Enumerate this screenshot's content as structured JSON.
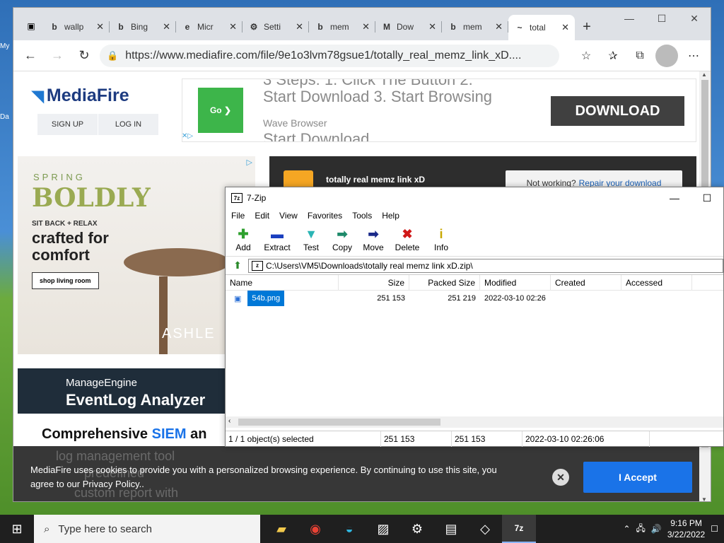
{
  "desktop": {
    "labels": [
      "My",
      "Da"
    ]
  },
  "browser": {
    "tabs": [
      {
        "label": "wallp",
        "fav": "b"
      },
      {
        "label": "Bing",
        "fav": "b"
      },
      {
        "label": "Micr",
        "fav": "e"
      },
      {
        "label": "Setti",
        "fav": "⚙"
      },
      {
        "label": "mem",
        "fav": "b"
      },
      {
        "label": "Dow",
        "fav": "M"
      },
      {
        "label": "mem",
        "fav": "b"
      },
      {
        "label": "total",
        "fav": "~"
      }
    ],
    "url": "https://www.mediafire.com/file/9e1o3lvm78gsue1/totally_real_memz_link_xD...."
  },
  "page": {
    "logo": "MediaFire",
    "signup": "SIGN UP",
    "login": "LOG IN",
    "top_ad": {
      "go": "Go ❯",
      "line1": "3 Steps: 1. Click The Button 2.",
      "line2": "Start Download 3. Start Browsing",
      "line3": "Wave Browser",
      "line4": "Start Download",
      "download": "DOWNLOAD"
    },
    "side_ad": {
      "spring": "SPRING",
      "boldly": "BOLDLY",
      "sit": "SIT BACK + RELAX",
      "crafted": "crafted for comfort",
      "cta": "shop living room",
      "brand": "ASHLE"
    },
    "manage_ad": {
      "line1": "ManageEngine",
      "line2": "EventLog Analyzer"
    },
    "siem": {
      "pre": "Comprehensive ",
      "blue": "SIEM",
      "post": " an"
    },
    "file_name": "totally real memz link xD",
    "not_working": "Not working?",
    "repair": "Repair your download",
    "cookie": {
      "text": "MediaFire uses cookies to provide you with a personalized browsing experience. By continuing to use this site, you agree to our Privacy Policy..",
      "accept": "I Accept",
      "ghost1": "log management tool",
      "ghost2": "predefined",
      "ghost3": "custom report with"
    }
  },
  "zip": {
    "title": "7-Zip",
    "menu": [
      "File",
      "Edit",
      "View",
      "Favorites",
      "Tools",
      "Help"
    ],
    "toolbar": [
      {
        "label": "Add",
        "icon": "plus-icon",
        "glyph": "✚",
        "color": "#2ea02e"
      },
      {
        "label": "Extract",
        "icon": "minus-icon",
        "glyph": "▬",
        "color": "#1a3fbf"
      },
      {
        "label": "Test",
        "icon": "check-icon",
        "glyph": "▼",
        "color": "#2bb5b5"
      },
      {
        "label": "Copy",
        "icon": "copy-arrow-icon",
        "glyph": "➡",
        "color": "#1e8a6a"
      },
      {
        "label": "Move",
        "icon": "move-arrow-icon",
        "glyph": "➡",
        "color": "#1a2a8a"
      },
      {
        "label": "Delete",
        "icon": "delete-x-icon",
        "glyph": "✖",
        "color": "#d01818"
      },
      {
        "label": "Info",
        "icon": "info-icon",
        "glyph": "i",
        "color": "#c8a800"
      }
    ],
    "path": "C:\\Users\\VM5\\Downloads\\totally real memz link xD.zip\\",
    "columns": [
      "Name",
      "Size",
      "Packed Size",
      "Modified",
      "Created",
      "Accessed"
    ],
    "rows": [
      {
        "name": "54b.png",
        "size": "251 153",
        "packed": "251 219",
        "modified": "2022-03-10 02:26",
        "created": "",
        "accessed": ""
      }
    ],
    "status": {
      "selected": "1 / 1 object(s) selected",
      "size": "251 153",
      "packed": "251 153",
      "modified": "2022-03-10 02:26:06"
    }
  },
  "taskbar": {
    "search_placeholder": "Type here to search",
    "time": "9:16 PM",
    "date": "3/22/2022"
  }
}
